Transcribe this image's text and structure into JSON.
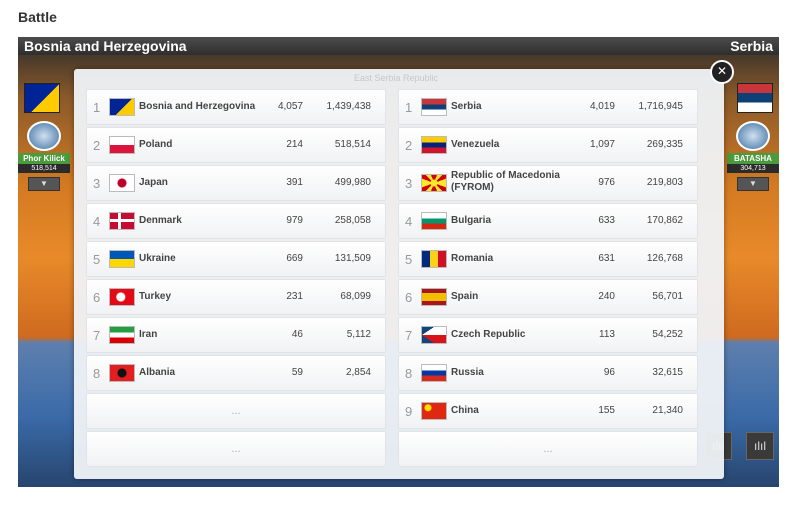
{
  "page": {
    "heading": "Battle"
  },
  "battle": {
    "left_side": "Bosnia and Herzegovina",
    "right_side": "Serbia",
    "left_hero": {
      "name": "Phor Kilick",
      "damage": "518,514"
    },
    "right_hero": {
      "name": "BATASHA",
      "damage": "304,713"
    },
    "dropdown_glyph": "▼",
    "stats_glyph": "ılıl"
  },
  "modal": {
    "faded_title": "East Serbia Republic",
    "close_glyph": "✕",
    "more_label": "...",
    "left": [
      {
        "rank": "1",
        "flag": "bih",
        "country": "Bosnia and Herzegovina",
        "kills": "4,057",
        "damage": "1,439,438"
      },
      {
        "rank": "2",
        "flag": "pol",
        "country": "Poland",
        "kills": "214",
        "damage": "518,514"
      },
      {
        "rank": "3",
        "flag": "jpn",
        "country": "Japan",
        "kills": "391",
        "damage": "499,980"
      },
      {
        "rank": "4",
        "flag": "den",
        "country": "Denmark",
        "kills": "979",
        "damage": "258,058"
      },
      {
        "rank": "5",
        "flag": "ukr",
        "country": "Ukraine",
        "kills": "669",
        "damage": "131,509"
      },
      {
        "rank": "6",
        "flag": "tur",
        "country": "Turkey",
        "kills": "231",
        "damage": "68,099"
      },
      {
        "rank": "7",
        "flag": "irn",
        "country": "Iran",
        "kills": "46",
        "damage": "5,112"
      },
      {
        "rank": "8",
        "flag": "alb",
        "country": "Albania",
        "kills": "59",
        "damage": "2,854"
      }
    ],
    "right": [
      {
        "rank": "1",
        "flag": "srb",
        "country": "Serbia",
        "kills": "4,019",
        "damage": "1,716,945"
      },
      {
        "rank": "2",
        "flag": "ven",
        "country": "Venezuela",
        "kills": "1,097",
        "damage": "269,335"
      },
      {
        "rank": "3",
        "flag": "mkd",
        "country": "Republic of Macedonia (FYROM)",
        "kills": "976",
        "damage": "219,803"
      },
      {
        "rank": "4",
        "flag": "bul",
        "country": "Bulgaria",
        "kills": "633",
        "damage": "170,862"
      },
      {
        "rank": "5",
        "flag": "rou",
        "country": "Romania",
        "kills": "631",
        "damage": "126,768"
      },
      {
        "rank": "6",
        "flag": "esp",
        "country": "Spain",
        "kills": "240",
        "damage": "56,701"
      },
      {
        "rank": "7",
        "flag": "cze",
        "country": "Czech Republic",
        "kills": "113",
        "damage": "54,252"
      },
      {
        "rank": "8",
        "flag": "rus",
        "country": "Russia",
        "kills": "96",
        "damage": "32,615"
      },
      {
        "rank": "9",
        "flag": "chn",
        "country": "China",
        "kills": "155",
        "damage": "21,340"
      }
    ]
  }
}
